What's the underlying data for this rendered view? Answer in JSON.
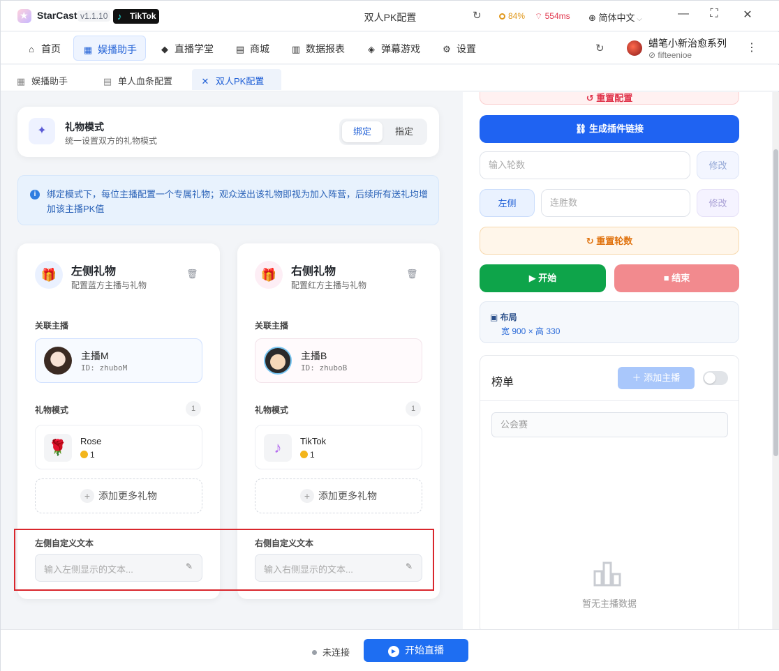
{
  "app": {
    "name": "StarCast",
    "version": "v1.1.10",
    "platform_badge": "TikTok",
    "window_title": "双人PK配置"
  },
  "status": {
    "cpu": "84%",
    "ping": "554ms",
    "language": "简体中文"
  },
  "nav": {
    "items": [
      {
        "label": "首页",
        "icon": "home-icon"
      },
      {
        "label": "娱播助手",
        "icon": "grid-icon"
      },
      {
        "label": "直播学堂",
        "icon": "graduation-cap-icon"
      },
      {
        "label": "商城",
        "icon": "store-icon"
      },
      {
        "label": "数据报表",
        "icon": "bar-chart-icon"
      },
      {
        "label": "弹幕游戏",
        "icon": "gamepad-icon"
      },
      {
        "label": "设置",
        "icon": "gear-icon"
      }
    ]
  },
  "user": {
    "name": "蜡笔小新治愈系列",
    "id": "fifteenioe"
  },
  "subtabs": [
    {
      "label": "娱播助手",
      "icon": "grid-icon"
    },
    {
      "label": "单人血条配置",
      "icon": "document-icon"
    },
    {
      "label": "双人PK配置",
      "icon": "crossed-swords-icon"
    }
  ],
  "gift_mode": {
    "title": "礼物模式",
    "subtitle": "统一设置双方的礼物模式",
    "options": [
      "绑定",
      "指定"
    ],
    "selected": "绑定"
  },
  "info_text": "绑定模式下，每位主播配置一个专属礼物；观众送出该礼物即视为加入阵营，后续所有送礼均增加该主播PK值",
  "left": {
    "title": "左侧礼物",
    "subtitle": "配置蓝方主播与礼物",
    "accent": "#1f5fd6",
    "linked_label": "关联主播",
    "streamer_name": "主播M",
    "streamer_id": "ID: zhuboM",
    "gift_mode_label": "礼物模式",
    "gift_count": "1",
    "gift_name": "Rose",
    "gift_price": "1",
    "add_more": "添加更多礼物",
    "custom_label": "左侧自定义文本",
    "custom_placeholder": "输入左侧显示的文本..."
  },
  "right": {
    "title": "右侧礼物",
    "subtitle": "配置红方主播与礼物",
    "accent": "#e0347a",
    "linked_label": "关联主播",
    "streamer_name": "主播B",
    "streamer_id": "ID: zhuboB",
    "gift_mode_label": "礼物模式",
    "gift_count": "1",
    "gift_name": "TikTok",
    "gift_price": "1",
    "add_more": "添加更多礼物",
    "custom_label": "右侧自定义文本",
    "custom_placeholder": "输入右侧显示的文本..."
  },
  "controls": {
    "reset_config": "重置配置",
    "gen_link": "生成插件链接",
    "rounds_placeholder": "输入轮数",
    "modify": "修改",
    "side_button": "左侧",
    "streak_placeholder": "连胜数",
    "reset_rounds": "重置轮数",
    "start": "开始",
    "end": "结束",
    "layout_title": "布局",
    "layout_size": "宽 900 × 高 330"
  },
  "ranking": {
    "title": "榜单",
    "add_streamer": "添加主播",
    "guild_placeholder": "公会赛",
    "empty": "暂无主播数据"
  },
  "footer": {
    "status": "未连接",
    "go_live": "开始直播"
  }
}
